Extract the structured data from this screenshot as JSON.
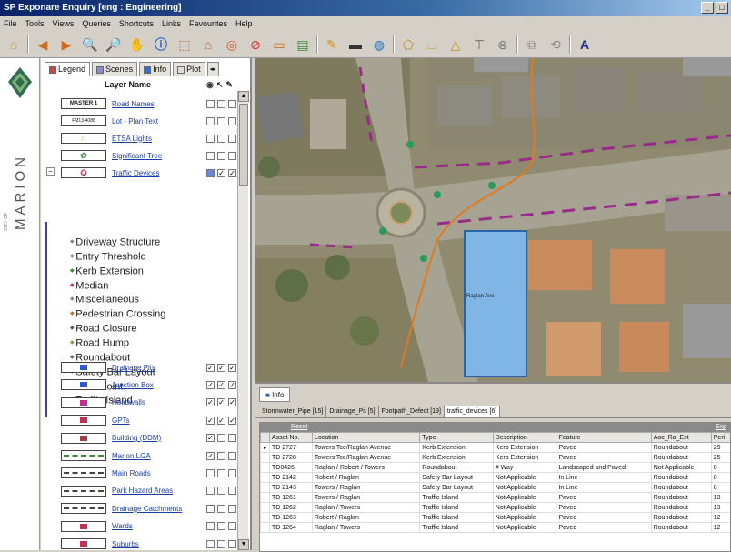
{
  "window": {
    "title": "SP Exponare Enquiry [eng : Engineering]",
    "buttons": [
      "_",
      "□"
    ]
  },
  "menu": [
    "File",
    "Tools",
    "Views",
    "Queries",
    "Shortcuts",
    "Links",
    "Favourites",
    "Help"
  ],
  "toolbar": {
    "icons": [
      "home-icon",
      "back-icon",
      "forward-icon",
      "zoom-in-icon",
      "zoom-out-icon",
      "pan-icon",
      "info-icon",
      "select-icon",
      "identify-icon",
      "buffer-icon",
      "clear-icon",
      "measure-icon",
      "layer-icon",
      "pencil-icon",
      "print-icon",
      "globe-icon",
      "polygon-icon",
      "area-icon",
      "gis-icon",
      "stop-icon",
      "bookmark-icon",
      "refresh-icon",
      "label-icon"
    ]
  },
  "branding": {
    "name": "MARION",
    "small": "CITY OF"
  },
  "legend": {
    "tabs": [
      "Legend",
      "Scenes",
      "Info",
      "Plot"
    ],
    "header": "Layer Name",
    "layers": [
      {
        "swatch": "MASTER 1",
        "name": "Road Names",
        "checks": [
          "",
          "",
          ""
        ]
      },
      {
        "swatch": "FM13-4088",
        "name": "Lot - Plan Text",
        "checks": [
          "",
          "",
          ""
        ]
      },
      {
        "swatch": "",
        "name": "ETSA Lights",
        "checks": [
          "",
          "",
          ""
        ]
      },
      {
        "swatch": "",
        "name": "Significant Tree",
        "checks": [
          "",
          "",
          ""
        ]
      },
      {
        "swatch": "",
        "name": "Traffic Devices",
        "checks": [
          "",
          "✓",
          "✓"
        ]
      }
    ],
    "subitems": [
      "Driveway Structure",
      "Entry Threshold",
      "Kerb Extension",
      "Median",
      "Miscellaneous",
      "Pedestrian Crossing",
      "Road Closure",
      "Road Hump",
      "Roundabout",
      "Safety Bar Layout",
      "Slow Point",
      "Traffic Island"
    ],
    "subitem_colors": [
      "#888",
      "#888",
      "#3a8a3a",
      "#c0306a",
      "#888",
      "#c07030",
      "#555",
      "#7aa040",
      "#666",
      "#c03050",
      "#555",
      "#555"
    ],
    "layers2": [
      {
        "name": "Drainage Pits",
        "checks": [
          "✓",
          "✓",
          "✓"
        ]
      },
      {
        "name": "Junction Box",
        "checks": [
          "✓",
          "✓",
          "✓"
        ]
      },
      {
        "name": "Headwalls",
        "checks": [
          "✓",
          "✓",
          "✓"
        ]
      },
      {
        "name": "GPTs",
        "checks": [
          "✓",
          "✓",
          "✓"
        ]
      },
      {
        "name": "Building (DDM)",
        "checks": [
          "✓",
          "",
          ""
        ]
      },
      {
        "name": "Marion LGA",
        "checks": [
          "✓",
          "",
          ""
        ]
      },
      {
        "name": "Main Roads",
        "checks": [
          "",
          "",
          ""
        ]
      },
      {
        "name": "Park Hazard Areas",
        "checks": [
          "",
          "",
          ""
        ]
      },
      {
        "name": "Drainage Catchments",
        "checks": [
          "",
          "",
          ""
        ]
      },
      {
        "name": "Wards",
        "checks": [
          "",
          "",
          ""
        ]
      },
      {
        "name": "Suburbs",
        "checks": [
          "",
          "",
          ""
        ]
      }
    ]
  },
  "info": {
    "tab": "Info",
    "datatabs": [
      "Stormwater_Pipe [15]",
      "Drainage_Pit [5]",
      "Footpath_Defect [19]",
      "traffic_devices [6]"
    ],
    "reset": "Reset",
    "export": "Exp",
    "columns": [
      "Asset No.",
      "Location",
      "Type",
      "Description",
      "Feature",
      "Aoc_Ra_Est",
      "Peri"
    ],
    "rows": [
      [
        "TD 2727",
        "Towers Tce/Raglan Avenue",
        "Kerb Extension",
        "Kerb Extension",
        "Paved",
        "Roundabout",
        "29"
      ],
      [
        "TD 2728",
        "Towers Tce/Raglan Avenue",
        "Kerb Extension",
        "Kerb Extension",
        "Paved",
        "Roundabout",
        "25"
      ],
      [
        "TD0426",
        "Raglan / Robert / Towers",
        "Roundabout",
        "# Way",
        "Landscaped and Paved",
        "Not Applicable",
        "8"
      ],
      [
        "TD 2142",
        "Robert / Raglan",
        "Safety Bar Layout",
        "Not Applicable",
        "In Line",
        "Roundabout",
        "8"
      ],
      [
        "TD 2143",
        "Towers / Raglan",
        "Safety Bar Layout",
        "Not Applicable",
        "In Line",
        "Roundabout",
        "8"
      ],
      [
        "TD 1261",
        "Towers / Raglan",
        "Traffic Island",
        "Not Applicable",
        "Paved",
        "Roundabout",
        "13"
      ],
      [
        "TD 1262",
        "Raglan / Towers",
        "Traffic Island",
        "Not Applicable",
        "Paved",
        "Roundabout",
        "13"
      ],
      [
        "TD 1263",
        "Robert / Raglan",
        "Traffic Island",
        "Not Applicable",
        "Paved",
        "Roundabout",
        "12"
      ],
      [
        "TD 1264",
        "Raglan / Towers",
        "Traffic Island",
        "Not Applicable",
        "Paved",
        "Roundabout",
        "12"
      ]
    ]
  },
  "map": {
    "label1": "Raglan Ave"
  }
}
